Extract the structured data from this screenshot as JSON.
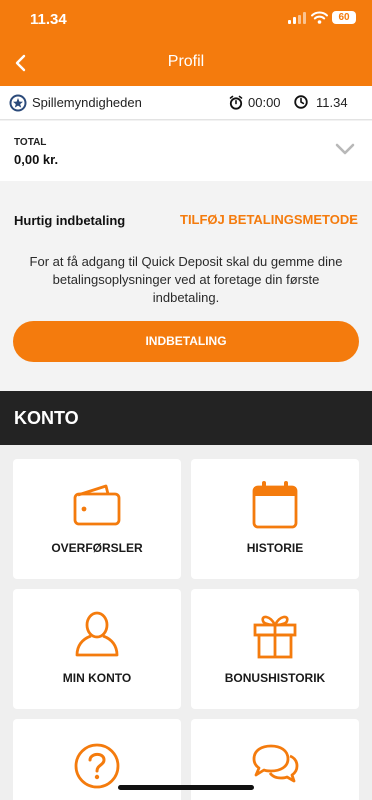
{
  "status_bar": {
    "time": "11.34",
    "battery": "60",
    "signal_icon": "cellular-signal-icon",
    "wifi_icon": "wifi-icon",
    "battery_icon": "battery-icon"
  },
  "nav": {
    "title": "Profil",
    "back_icon": "chevron-left-icon"
  },
  "info_bar": {
    "regulator": "Spillemyndigheden",
    "session_timer": "00:00",
    "clock": "11.34"
  },
  "total": {
    "label": "TOTAL",
    "value": "0,00 kr."
  },
  "quick_deposit": {
    "label": "Hurtig indbetaling",
    "add_method": "TILFØJ BETALINGSMETODE",
    "add_chevron": "›",
    "description": "For at få adgang til Quick Deposit skal du gemme dine betalingsoplysninger ved at foretage din første indbetaling.",
    "button": "INDBETALING"
  },
  "konto": {
    "title": "KONTO",
    "tiles": [
      {
        "label": "OVERFØRSLER",
        "icon": "wallet-icon"
      },
      {
        "label": "HISTORIE",
        "icon": "calendar-icon"
      },
      {
        "label": "MIN KONTO",
        "icon": "user-icon"
      },
      {
        "label": "BONUSHISTORIK",
        "icon": "gift-icon"
      },
      {
        "label": "",
        "icon": "help-icon"
      },
      {
        "label": "",
        "icon": "chat-icon"
      }
    ]
  },
  "colors": {
    "accent": "#f47b0d",
    "header_dark": "#232323",
    "background": "#f2f2f2"
  }
}
